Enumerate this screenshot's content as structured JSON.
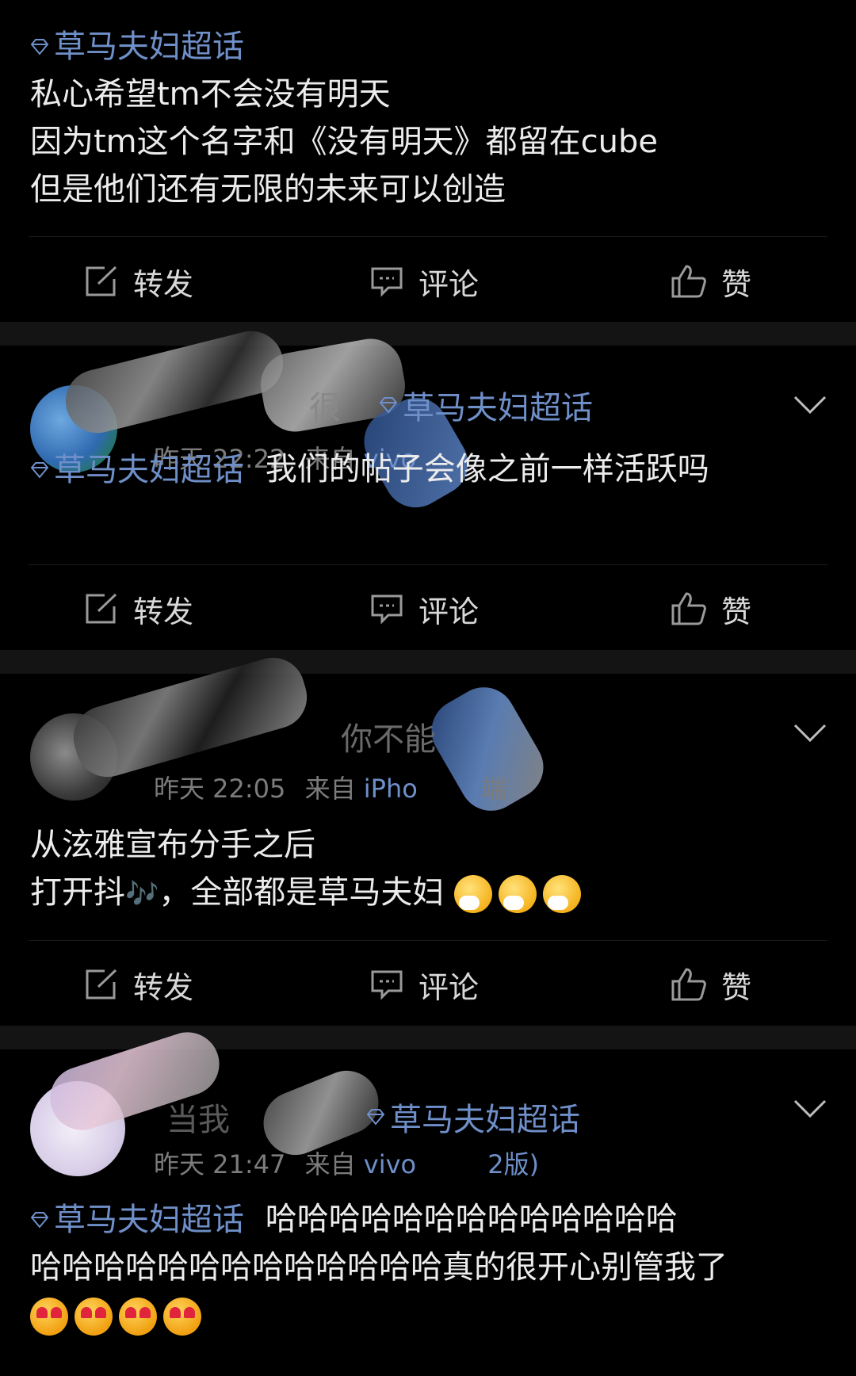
{
  "topic_tag": "草马夫妇超话",
  "actions": {
    "repost": "转发",
    "comment": "评论",
    "like": "赞"
  },
  "post1": {
    "lines": [
      "私心希望tm不会没有明天",
      "因为tm这个名字和《没有明天》都留在cube",
      "但是他们还有无限的未来可以创造"
    ]
  },
  "post2": {
    "name": "很",
    "meta_time": "昨天 22:22",
    "meta_from": "来自",
    "meta_source": "vivo",
    "body": "我们的帖子会像之前一样活跃吗"
  },
  "post3": {
    "name": "你不能",
    "meta_time": "昨天 22:05",
    "meta_from": "来自",
    "meta_source": "iPho",
    "meta_tail": "端",
    "line1": "从泫雅宣布分手之后",
    "line2_a": "打开抖",
    "line2_note": "🎶",
    "line2_b": "，全部都是草马夫妇"
  },
  "post4": {
    "name": "当我",
    "meta_time": "昨天 21:47",
    "meta_from": "来自",
    "meta_source": "vivo",
    "meta_tail": "2版)",
    "line1": "哈哈哈哈哈哈哈哈哈哈哈哈哈",
    "line2": "哈哈哈哈哈哈哈哈哈哈哈哈哈真的很开心别管我了"
  },
  "colors": {
    "accent": "#6f8fc9",
    "background": "#000000",
    "separator": "#141414"
  },
  "icons": [
    "diamond-icon",
    "repost-icon",
    "comment-icon",
    "like-icon",
    "chevron-down-icon"
  ]
}
